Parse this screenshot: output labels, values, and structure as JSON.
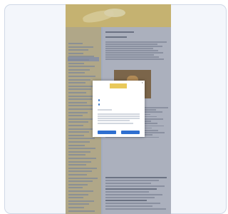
{
  "site": {
    "logo_text": "",
    "photo_label": ""
  },
  "modal": {
    "logo_text": "",
    "close_glyph": "×",
    "title": "",
    "options": [
      {
        "label": "",
        "selected": true
      },
      {
        "label": "",
        "selected": false
      }
    ],
    "buttons": [
      {
        "label": ""
      },
      {
        "label": ""
      }
    ]
  }
}
